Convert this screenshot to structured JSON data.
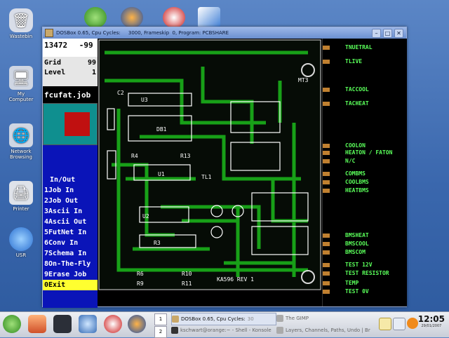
{
  "desktop": {
    "icons": [
      {
        "label": "Wastebin"
      },
      {
        "label": "My\nComputer"
      },
      {
        "label": "Network\nBrowsing"
      },
      {
        "label": "Printer"
      },
      {
        "label": "USR"
      }
    ]
  },
  "window": {
    "title": "DOSBox 0.65, Cpu Cycles:     3000, Frameskip  0, Program: PCBSHARE"
  },
  "dos": {
    "coords": {
      "x": "13472",
      "y": "-99"
    },
    "grid_label": "Grid",
    "grid_value": "99",
    "level_label": "Level",
    "level_value": "1",
    "job_name": "fcufat.job",
    "menu_header": "In/Out",
    "menu": [
      {
        "key": "1",
        "label": "Job In"
      },
      {
        "key": "2",
        "label": "Job Out"
      },
      {
        "key": "3",
        "label": "Ascii In"
      },
      {
        "key": "4",
        "label": "Ascii Out"
      },
      {
        "key": "5",
        "label": "FutNet In"
      },
      {
        "key": "6",
        "label": "Conv In"
      },
      {
        "key": "7",
        "label": "Schema In"
      },
      {
        "key": "8",
        "label": "On-The-Fly"
      },
      {
        "key": "9",
        "label": "Erase Job"
      },
      {
        "key": "0",
        "label": "Exit"
      }
    ],
    "board_text": {
      "u3": "U3",
      "db1": "DB1",
      "u1": "U1",
      "u2": "U2",
      "r3": "R3",
      "r4": "R4",
      "r13": "R13",
      "tl1": "TL1",
      "r10": "R10",
      "r11": "R11",
      "r6": "R6",
      "r9": "R9",
      "c2": "C2",
      "mt3": "MT3",
      "brd": "KA596 REV 1"
    },
    "signals": [
      "TNUETRAL",
      "TLIVE",
      "TACCOOL",
      "TACHEAT",
      "COOLON",
      "HEATON / FATON",
      "N/C",
      "COMBMS",
      "COOLBMS",
      "HEATBMS",
      "BMSHEAT",
      "BMSCOOL",
      "BMSCOM",
      "TEST 12V",
      "TEST RESISTOR",
      "TEMP",
      "TEST 0V"
    ]
  },
  "taskbar": {
    "pager": [
      "1",
      "2"
    ],
    "tasks": [
      {
        "label": "DOSBox 0.65, Cpu Cycles:",
        "extra": "30"
      },
      {
        "label": "The GIMP"
      },
      {
        "label": "kschwart@orange:~ - Shell - Konsole"
      },
      {
        "label": "Layers, Channels, Paths, Undo | Br"
      }
    ],
    "clock": "12:05",
    "date": "29/01/2007"
  },
  "colors": {
    "accent": "#0a14b8",
    "copper": "#c08030",
    "silk": "#ffffff",
    "signal": "#5aff5a"
  }
}
